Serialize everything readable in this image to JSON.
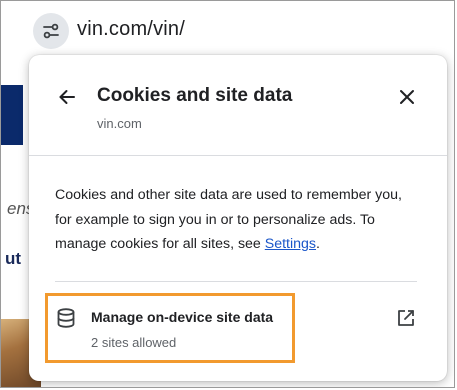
{
  "omnibox": {
    "url": "vin.com/vin/"
  },
  "background_page": {
    "left_fragment_1": "ens",
    "left_fragment_2": "ut",
    "right_fragment_1": "",
    "right_fragment_2": "",
    "right_fragment_3": "",
    "right_fragment_4": ""
  },
  "popup": {
    "title": "Cookies and site data",
    "subtitle": "vin.com",
    "description_text": "Cookies and other site data are used to remember you, for example to sign you in or to personalize ads. To manage cookies for all sites, see ",
    "settings_link": "Settings",
    "description_end": ".",
    "manage": {
      "title": "Manage on-device site data",
      "subtitle": "2 sites allowed"
    }
  },
  "colors": {
    "highlight": "#f29a2e",
    "link": "#1a56c9"
  },
  "icons": [
    "site-info-icon",
    "back-arrow-icon",
    "close-icon",
    "database-icon",
    "open-in-new-icon"
  ]
}
